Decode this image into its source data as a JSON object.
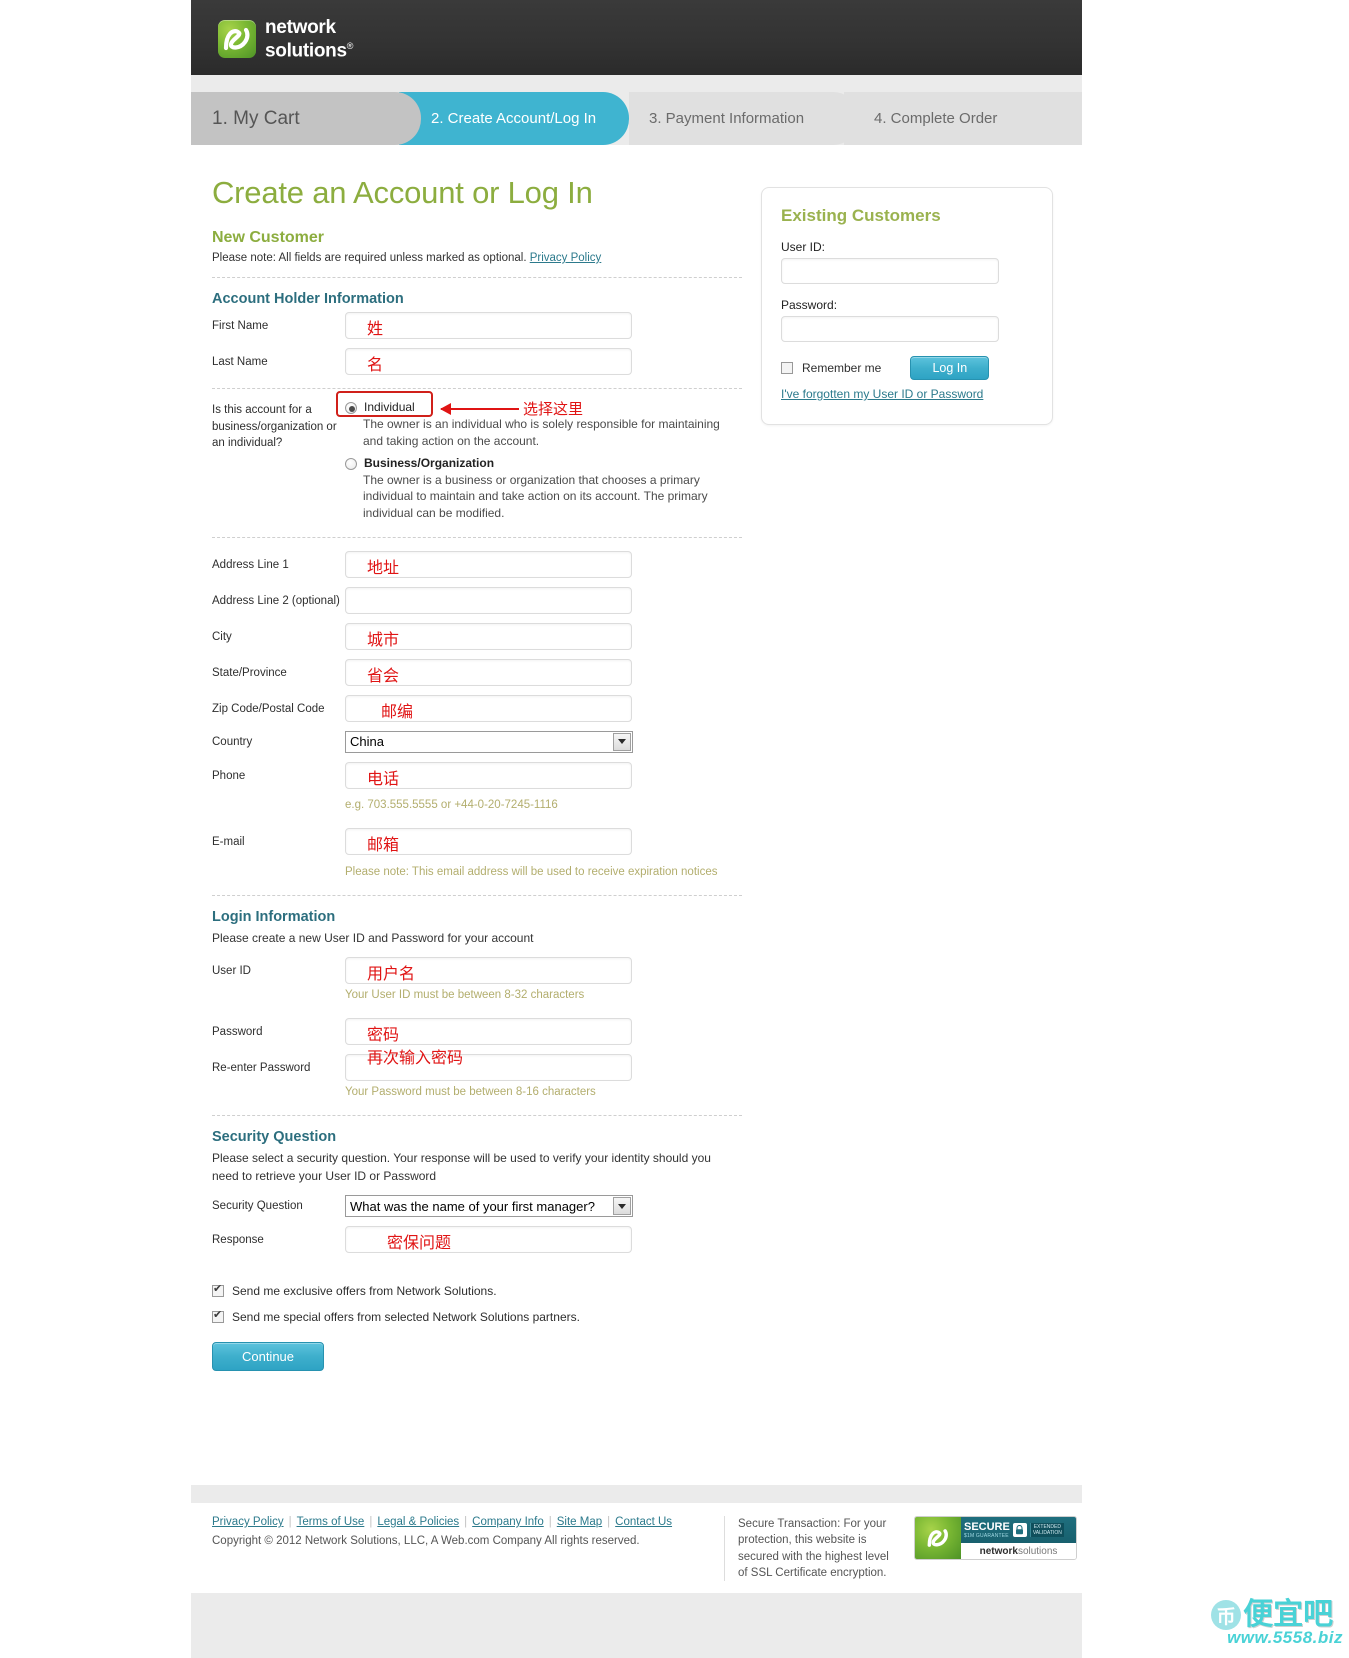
{
  "brand": {
    "name_line1": "network",
    "name_line2": "solutions",
    "registered": "®",
    "logo_icon": "ns-logo-icon"
  },
  "steps": [
    {
      "label": "1. My Cart",
      "state": "done"
    },
    {
      "label": "2. Create Account/Log In",
      "state": "active"
    },
    {
      "label": "3. Payment Information",
      "state": "upcoming"
    },
    {
      "label": "4. Complete Order",
      "state": "upcoming"
    }
  ],
  "page": {
    "title": "Create an Account or Log In"
  },
  "new_customer": {
    "heading": "New Customer",
    "note_prefix": "Please note: All fields are required unless marked as optional.",
    "privacy_link": "Privacy Policy"
  },
  "account_holder": {
    "heading": "Account Holder Information",
    "first_name": {
      "label": "First Name",
      "annotation": "姓"
    },
    "last_name": {
      "label": "Last Name",
      "annotation": "名"
    },
    "account_type": {
      "label": "Is this account for a business/organization or an individual?",
      "options": [
        {
          "label": "Individual",
          "description": "The owner is an individual who is solely responsible for maintaining and taking action on the account.",
          "selected": true
        },
        {
          "label": "Business/Organization",
          "description": "The owner is a business or organization that chooses a primary individual to maintain and take action on its account. The primary individual can be modified.",
          "selected": false
        }
      ],
      "annotation": "选择这里"
    },
    "address1": {
      "label": "Address Line 1",
      "annotation": "地址"
    },
    "address2": {
      "label": "Address Line 2 (optional)",
      "annotation": ""
    },
    "city": {
      "label": "City",
      "annotation": "城市"
    },
    "state": {
      "label": "State/Province",
      "annotation": "省会"
    },
    "zip": {
      "label": "Zip Code/Postal Code",
      "annotation": "邮编"
    },
    "country": {
      "label": "Country",
      "value": "China"
    },
    "phone": {
      "label": "Phone",
      "annotation": "电话",
      "hint": "e.g. 703.555.5555 or +44-0-20-7245-1116"
    },
    "email": {
      "label": "E-mail",
      "annotation": "邮箱",
      "hint": "Please note: This email address will be used to receive expiration notices"
    }
  },
  "login_information": {
    "heading": "Login Information",
    "description": "Please create a new User ID and Password for your account",
    "user_id": {
      "label": "User ID",
      "annotation": "用户名",
      "hint": "Your User ID must be between 8-32 characters"
    },
    "password": {
      "label": "Password",
      "annotation": "密码"
    },
    "reenter_password": {
      "label": "Re-enter Password",
      "annotation": "再次输入密码",
      "hint": "Your Password must be between 8-16 characters"
    }
  },
  "security_question": {
    "heading": "Security Question",
    "description": "Please select a security question. Your response will be used to verify your identity should you need to retrieve your User ID or Password",
    "question": {
      "label": "Security Question",
      "value": "What was the name of your first manager?"
    },
    "response": {
      "label": "Response",
      "annotation": "密保问题"
    }
  },
  "offers": [
    {
      "label": "Send me exclusive offers from Network Solutions.",
      "checked": true
    },
    {
      "label": "Send me special offers from selected Network Solutions partners.",
      "checked": true
    }
  ],
  "continue_button": "Continue",
  "existing_customers": {
    "heading": "Existing Customers",
    "user_id_label": "User ID:",
    "user_id_value": "",
    "password_label": "Password:",
    "password_value": "",
    "remember_me": "Remember me",
    "remember_me_checked": false,
    "login_button": "Log In",
    "forgot_link": "I've forgotten my User ID or Password"
  },
  "footer": {
    "links": [
      "Privacy Policy",
      "Terms of Use",
      "Legal & Policies",
      "Company Info",
      "Site Map",
      "Contact Us"
    ],
    "copyright": "Copyright © 2012 Network Solutions, LLC, A Web.com Company All rights reserved.",
    "secure_text": "Secure Transaction: For your protection, this website is secured with the highest level of SSL Certificate encryption.",
    "seal": {
      "secure": "SECURE",
      "guarantee": "$1M GUARANTEE",
      "ev_line1": "EXTENDED",
      "ev_line2": "VALIDATION",
      "brand_bold": "network",
      "brand_light": "solutions",
      "lock_icon": "lock-icon"
    }
  },
  "watermark": {
    "glyph": "币",
    "text": "便宜吧",
    "url": "www.5558.biz"
  },
  "colors": {
    "accent_blue": "#3fb4d0",
    "green": "#8cad3f",
    "teal": "#2c6e7e",
    "annotation_red": "#e01414",
    "header_dark": "#333333"
  }
}
